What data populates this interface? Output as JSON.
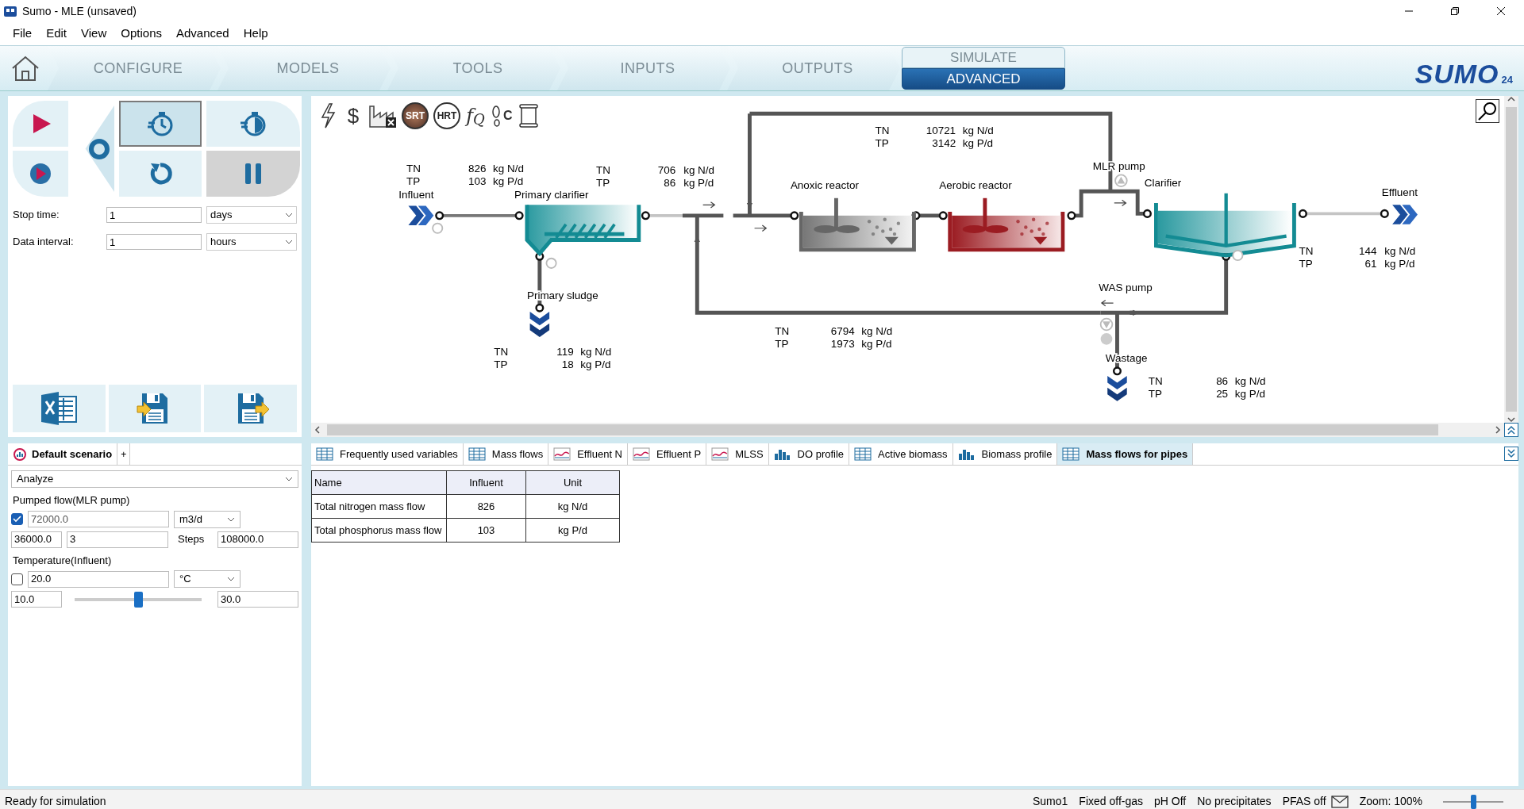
{
  "window": {
    "title": "Sumo - MLE (unsaved)"
  },
  "menu": [
    "File",
    "Edit",
    "View",
    "Options",
    "Advanced",
    "Help"
  ],
  "nav_tabs": [
    {
      "label": "CONFIGURE",
      "selected": false
    },
    {
      "label": "MODELS",
      "selected": false
    },
    {
      "label": "TOOLS",
      "selected": false
    },
    {
      "label": "INPUTS",
      "selected": false
    },
    {
      "label": "OUTPUTS",
      "selected": false
    }
  ],
  "simulate": {
    "label": "SIMULATE",
    "subtab": {
      "label": "ADVANCED",
      "selected": true
    }
  },
  "logo": {
    "text": "SUMO",
    "version": "24"
  },
  "simulation": {
    "stop_time": {
      "label": "Stop time:",
      "value": "1",
      "unit": "days"
    },
    "data_interval": {
      "label": "Data interval:",
      "value": "1",
      "unit": "hours"
    }
  },
  "diagram_toolbar": [
    {
      "kind": "lightning"
    },
    {
      "kind": "glyph",
      "text": "$"
    },
    {
      "kind": "factory"
    },
    {
      "kind": "dark-circle",
      "text": "SRT"
    },
    {
      "kind": "light-circle",
      "text": "HRT"
    },
    {
      "kind": "formula",
      "text": "f",
      "sub": "Q"
    },
    {
      "kind": "footprint",
      "text": "C"
    },
    {
      "kind": "scroll"
    }
  ],
  "flowsheet": {
    "units": [
      {
        "kind": "influent",
        "label": "Influent"
      },
      {
        "kind": "primary-clarifier",
        "label": "Primary clarifier"
      },
      {
        "kind": "sludge",
        "label": "Primary sludge"
      },
      {
        "kind": "anoxic",
        "label": "Anoxic reactor"
      },
      {
        "kind": "aerobic",
        "label": "Aerobic reactor"
      },
      {
        "kind": "pump-up",
        "label": "MLR pump"
      },
      {
        "kind": "clarifier",
        "label": "Clarifier"
      },
      {
        "kind": "effluent",
        "label": "Effluent"
      },
      {
        "kind": "pump-down",
        "label": "WAS pump"
      },
      {
        "kind": "sludge",
        "label": "Wastage"
      }
    ],
    "streams": [
      {
        "rows": [
          {
            "variable": "TN",
            "value": "826",
            "unit": "kg N/d"
          },
          {
            "variable": "TP",
            "value": "103",
            "unit": "kg P/d"
          }
        ]
      },
      {
        "rows": [
          {
            "variable": "TN",
            "value": "706",
            "unit": "kg N/d"
          },
          {
            "variable": "TP",
            "value": "86",
            "unit": "kg P/d"
          }
        ]
      },
      {
        "rows": [
          {
            "variable": "TN",
            "value": "10721",
            "unit": "kg N/d"
          },
          {
            "variable": "TP",
            "value": "3142",
            "unit": "kg P/d"
          }
        ]
      },
      {
        "rows": [
          {
            "variable": "TN",
            "value": "119",
            "unit": "kg N/d"
          },
          {
            "variable": "TP",
            "value": "18",
            "unit": "kg P/d"
          }
        ]
      },
      {
        "rows": [
          {
            "variable": "TN",
            "value": "6794",
            "unit": "kg N/d"
          },
          {
            "variable": "TP",
            "value": "1973",
            "unit": "kg P/d"
          }
        ]
      },
      {
        "rows": [
          {
            "variable": "TN",
            "value": "144",
            "unit": "kg N/d"
          },
          {
            "variable": "TP",
            "value": "61",
            "unit": "kg P/d"
          }
        ]
      },
      {
        "rows": [
          {
            "variable": "TN",
            "value": "86",
            "unit": "kg N/d"
          },
          {
            "variable": "TP",
            "value": "25",
            "unit": "kg P/d"
          }
        ]
      }
    ]
  },
  "scenario": {
    "title": "Default scenario",
    "add": "+",
    "mode": "Analyze",
    "parameters": [
      {
        "kind": "steps",
        "label": "Pumped flow(MLR pump)",
        "checked": true,
        "value": "72000.0",
        "unit": "m3/d",
        "min": "36000.0",
        "count": "3",
        "count_label": "Steps",
        "max": "108000.0"
      },
      {
        "kind": "slider",
        "label": "Temperature(Influent)",
        "checked": false,
        "value": "20.0",
        "unit": "°C",
        "min": "10.0",
        "max": "30.0",
        "level": 0.5
      }
    ]
  },
  "result_tabs": [
    {
      "kind": "table",
      "label": "Frequently used variables",
      "selected": false
    },
    {
      "kind": "table",
      "label": "Mass flows",
      "selected": false
    },
    {
      "kind": "line",
      "label": "Effluent N",
      "selected": false
    },
    {
      "kind": "line",
      "label": "Effluent P",
      "selected": false
    },
    {
      "kind": "line",
      "label": "MLSS",
      "selected": false
    },
    {
      "kind": "bar",
      "label": "DO profile",
      "selected": false
    },
    {
      "kind": "table",
      "label": "Active biomass",
      "selected": false
    },
    {
      "kind": "bar",
      "label": "Biomass profile",
      "selected": false
    },
    {
      "kind": "table",
      "label": "Mass flows for pipes",
      "selected": true
    }
  ],
  "table": {
    "columns": [
      "Name",
      "Influent",
      "Unit"
    ],
    "rows": [
      [
        "Total nitrogen mass flow",
        "826",
        "kg N/d"
      ],
      [
        "Total phosphorus mass flow",
        "103",
        "kg P/d"
      ]
    ]
  },
  "status_bar": {
    "message": "Ready for simulation",
    "items": [
      "Sumo1",
      "Fixed off-gas",
      "pH Off",
      "No precipitates",
      "PFAS off"
    ],
    "zoom": "Zoom: 100%",
    "zoom_level": {
      "level": 0.5
    }
  }
}
